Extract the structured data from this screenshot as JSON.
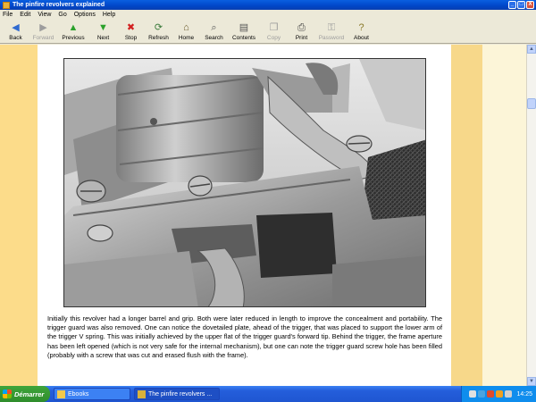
{
  "window": {
    "title": "The pinfire revolvers explained",
    "controls": [
      "_",
      "□",
      "X"
    ]
  },
  "menu": [
    "File",
    "Edit",
    "View",
    "Go",
    "Options",
    "Help"
  ],
  "toolbar": [
    {
      "label": "Back",
      "icon": "back-arrow-icon",
      "glyph": "◀",
      "color": "#2f6ad0",
      "enabled": true
    },
    {
      "label": "Forward",
      "icon": "forward-arrow-icon",
      "glyph": "▶",
      "color": "#9d9d9d",
      "enabled": false
    },
    {
      "label": "Previous",
      "icon": "up-arrow-icon",
      "glyph": "▲",
      "color": "#2aa12a",
      "enabled": true
    },
    {
      "label": "Next",
      "icon": "down-arrow-icon",
      "glyph": "▼",
      "color": "#2aa12a",
      "enabled": true
    },
    {
      "label": "Stop",
      "icon": "stop-icon",
      "glyph": "✖",
      "color": "#d22020",
      "enabled": true
    },
    {
      "label": "Refresh",
      "icon": "refresh-icon",
      "glyph": "⟳",
      "color": "#3a7a3a",
      "enabled": true
    },
    {
      "label": "Home",
      "icon": "home-icon",
      "glyph": "⌂",
      "color": "#6a5a2a",
      "enabled": true
    },
    {
      "label": "Search",
      "icon": "search-icon",
      "glyph": "⌕",
      "color": "#555555",
      "enabled": true
    },
    {
      "label": "Contents",
      "icon": "contents-icon",
      "glyph": "▤",
      "color": "#555555",
      "enabled": true
    },
    {
      "label": "Copy",
      "icon": "copy-icon",
      "glyph": "❐",
      "color": "#9d9d9d",
      "enabled": false
    },
    {
      "label": "Print",
      "icon": "print-icon",
      "glyph": "⎙",
      "color": "#444444",
      "enabled": true
    },
    {
      "label": "Password",
      "icon": "key-icon",
      "glyph": "⚿",
      "color": "#9d9d9d",
      "enabled": false
    },
    {
      "label": "About",
      "icon": "about-icon",
      "glyph": "?",
      "color": "#8a7a2a",
      "enabled": true
    }
  ],
  "content": {
    "paragraph": "Initially this revolver had a longer barrel and grip. Both were later reduced in length to improve the concealment and portability. The trigger guard was also removed. One can notice the dovetailed plate, ahead of the trigger, that was placed to support the lower arm of the trigger V spring. This was initially achieved by the upper flat of the trigger guard's forward tip. Behind the trigger, the frame aperture has been left opened (which is not very safe for the internal mechanism), but one can note the trigger guard screw hole has been filled (probably with a screw that was cut and erased flush with the frame)."
  },
  "taskbar": {
    "start_label": "Démarrer",
    "tasks": [
      {
        "label": "Ebooks",
        "icon": "folder-icon",
        "active": false
      },
      {
        "label": "The pinfire revolvers ...",
        "icon": "book-icon",
        "active": true
      }
    ],
    "clock": "14:25"
  }
}
